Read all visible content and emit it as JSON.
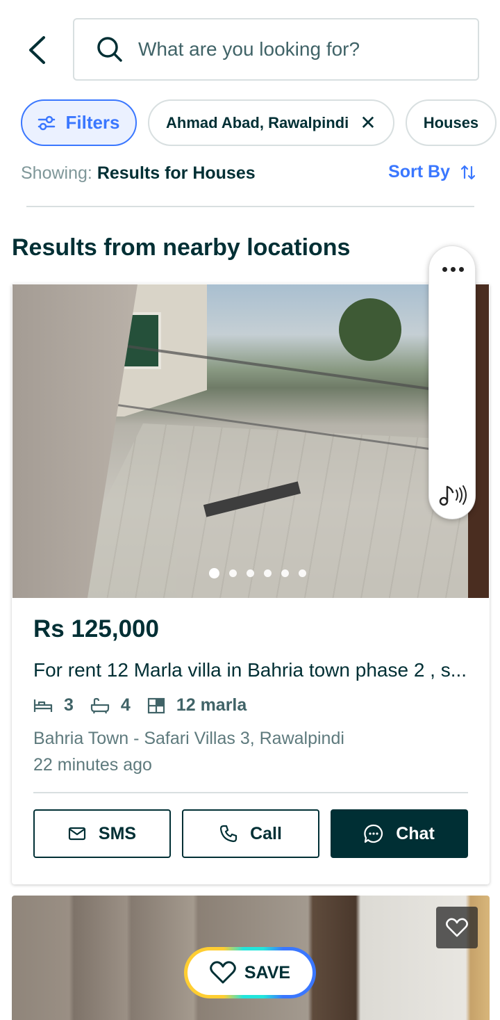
{
  "header": {
    "back_icon": "chevron-left-icon",
    "search_placeholder": "What are you looking for?"
  },
  "chips": {
    "filters_label": "Filters",
    "location_label": "Ahmad Abad, Rawalpindi",
    "location_clear": "✕",
    "category_label": "Houses"
  },
  "results_bar": {
    "showing_prefix": "Showing:",
    "showing_value": "Results for Houses",
    "sort_label": "Sort By"
  },
  "section_title": "Results from nearby locations",
  "listing": {
    "price": "Rs 125,000",
    "title": "For rent 12 Marla villa in Bahria town phase 2 , s...",
    "beds": "3",
    "baths": "4",
    "area": "12 marla",
    "location": "Bahria Town - Safari Villas 3, Rawalpindi",
    "posted": "22 minutes ago",
    "photo_count": 6,
    "active_photo": 1,
    "actions": {
      "sms": "SMS",
      "call": "Call",
      "chat": "Chat"
    }
  },
  "save_overlay": {
    "label": "SAVE"
  },
  "colors": {
    "brand_dark": "#002f34",
    "accent_blue": "#3a77ff",
    "muted_text": "#5e7a7d",
    "border": "#d8dfe0"
  }
}
